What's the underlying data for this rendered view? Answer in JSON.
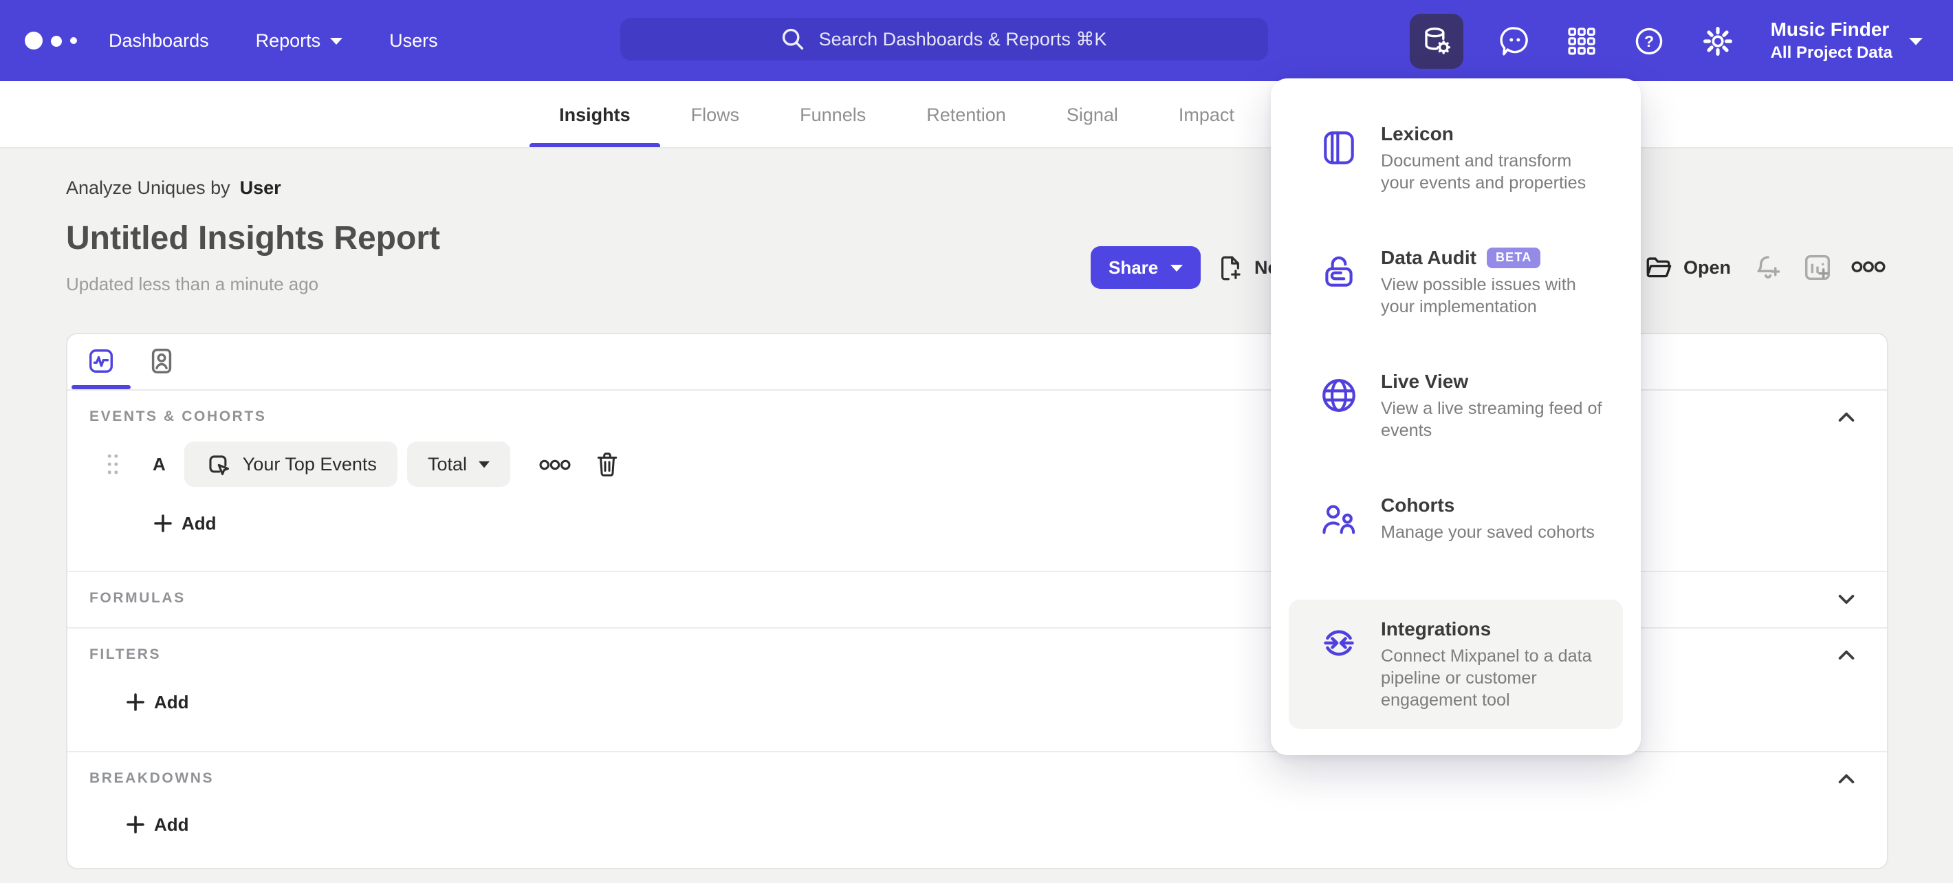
{
  "header": {
    "nav": [
      {
        "label": "Dashboards"
      },
      {
        "label": "Reports"
      },
      {
        "label": "Users"
      }
    ],
    "search": {
      "placeholder": "Search Dashboards & Reports ⌘K"
    },
    "project": {
      "name": "Music Finder",
      "scope": "All Project Data"
    },
    "icon_names": [
      "data-tools-icon",
      "feedback-icon",
      "apps-grid-icon",
      "help-icon",
      "settings-gear-icon",
      "project-caret-icon"
    ]
  },
  "report_tabs": [
    {
      "label": "Insights",
      "active": true
    },
    {
      "label": "Flows"
    },
    {
      "label": "Funnels"
    },
    {
      "label": "Retention"
    },
    {
      "label": "Signal"
    },
    {
      "label": "Impact"
    }
  ],
  "report": {
    "analyze_prefix": "Analyze Uniques by",
    "analyze_value": "User",
    "title": "Untitled Insights Report",
    "updated": "Updated less than a minute ago"
  },
  "actions": {
    "share": "Share",
    "new_report": "New",
    "open": "Open",
    "icon_names": [
      "new-report-icon",
      "open-folder-icon",
      "alert-bell-add-icon",
      "add-to-board-icon",
      "more-options-icon"
    ]
  },
  "builder": {
    "events_label": "EVENTS & COHORTS",
    "query_row": {
      "letter": "A",
      "event": "Your Top Events",
      "metric": "Total"
    },
    "add_label": "Add",
    "formulas_label": "FORMULAS",
    "filters_label": "FILTERS",
    "breakdowns_label": "BREAKDOWNS"
  },
  "tools_menu": {
    "items": [
      {
        "title": "Lexicon",
        "description": "Document and transform your events and properties",
        "icon": "lexicon-book-icon"
      },
      {
        "title": "Data Audit",
        "badge": "BETA",
        "description": "View possible issues with your implementation",
        "icon": "data-audit-lock-icon"
      },
      {
        "title": "Live View",
        "description": "View a live streaming feed of events",
        "icon": "live-view-globe-icon"
      },
      {
        "title": "Cohorts",
        "description": "Manage your saved cohorts",
        "icon": "cohorts-people-icon"
      },
      {
        "title": "Integrations",
        "description": "Connect Mixpanel to a data pipeline or customer engagement tool",
        "icon": "integrations-sync-icon",
        "hovered": true
      }
    ]
  },
  "colors": {
    "header_bg": "#4c43d9",
    "search_bg": "#423bc6",
    "active_tool_bg": "#3b3370",
    "accent": "#4f44e0",
    "share_button": "#4f45e2",
    "beta_badge": "#948be9",
    "page_bg": "#f2f2f1",
    "hover_row": "#f4f4f3"
  }
}
